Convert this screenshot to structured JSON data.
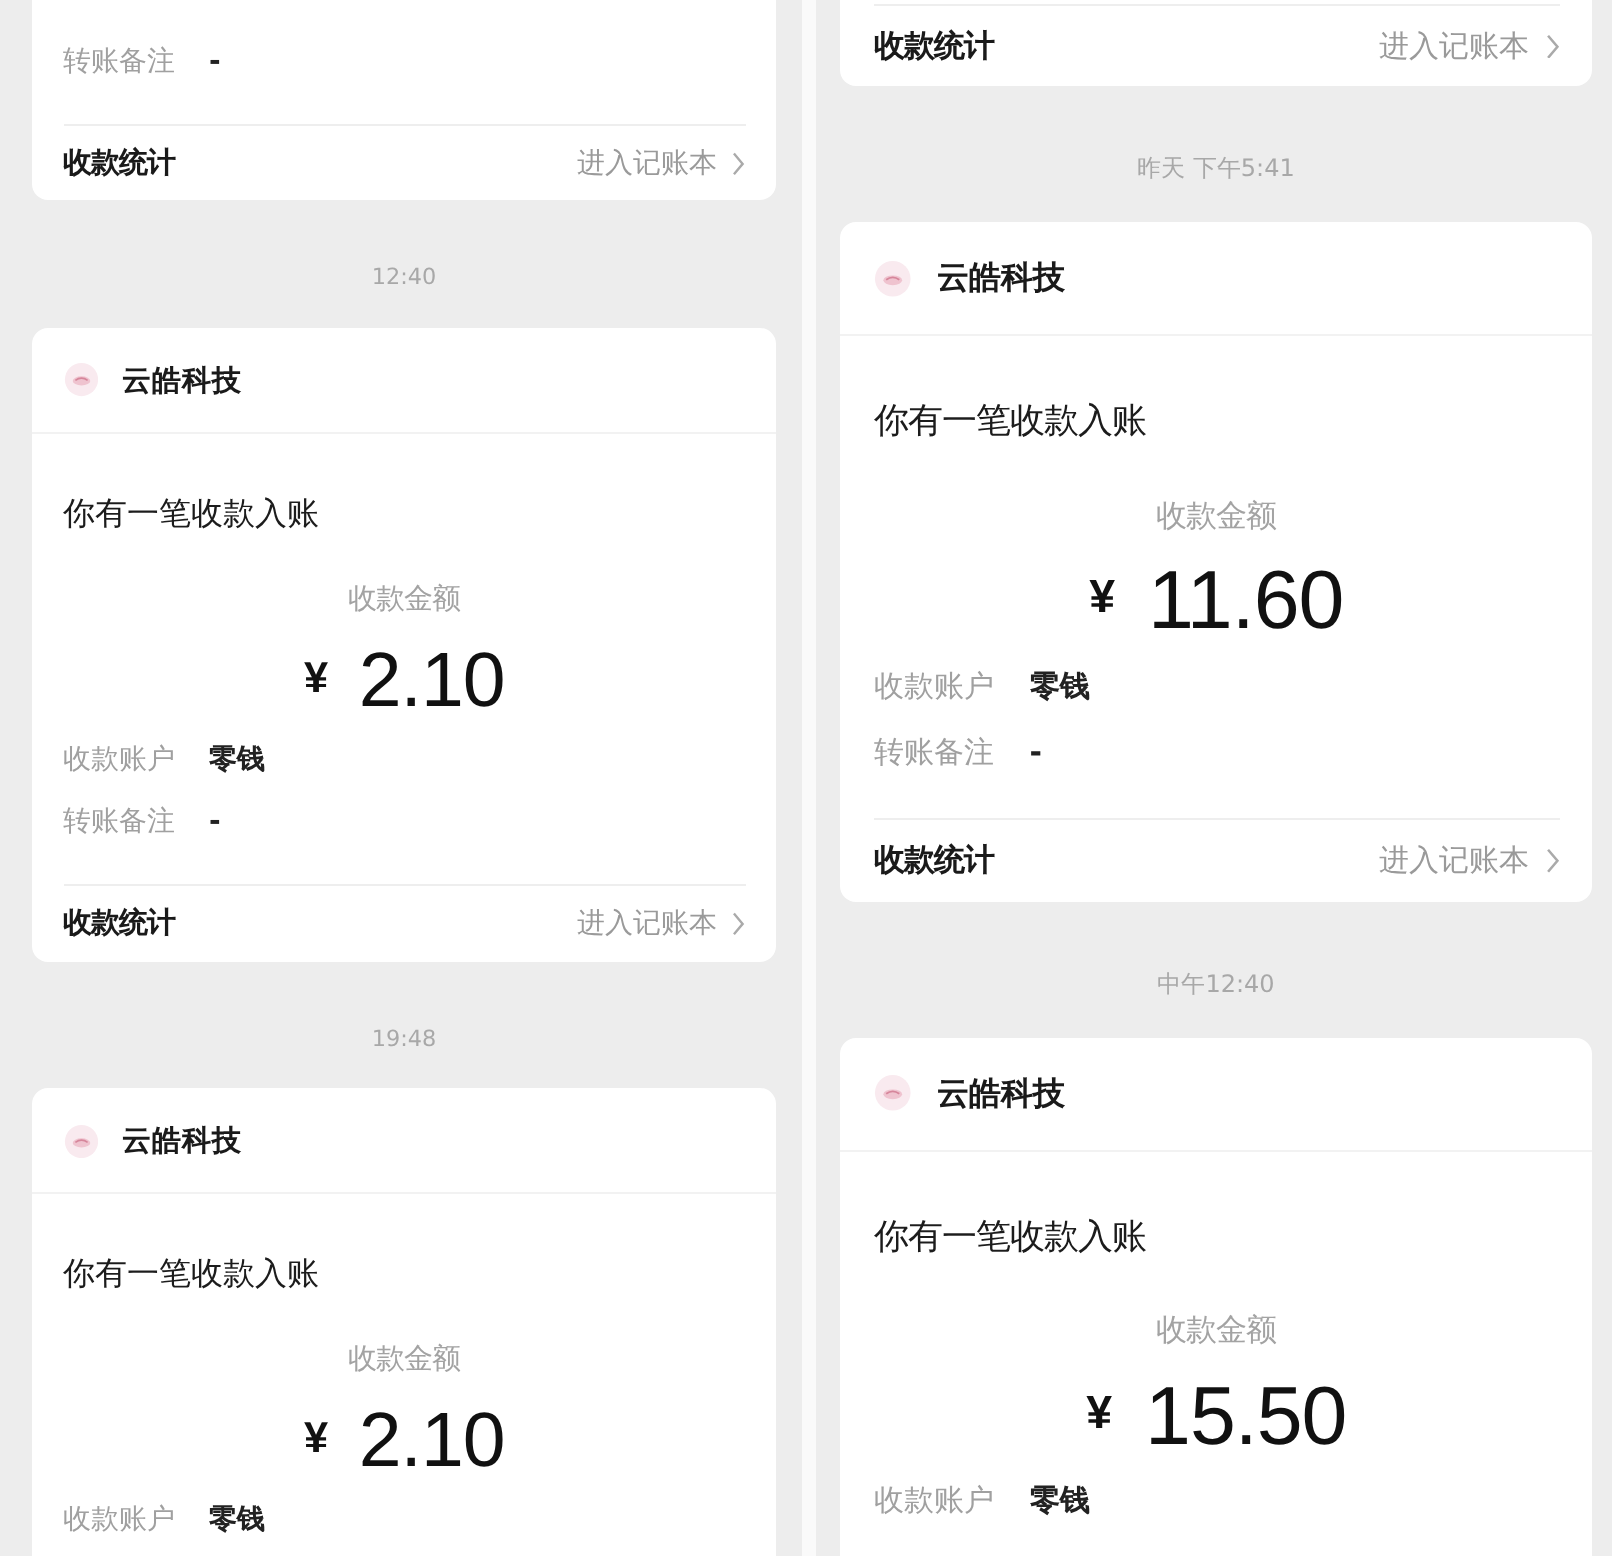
{
  "panels": [
    {
      "items": [
        {
          "kind": "card",
          "details": [
            {
              "label": "转账备注",
              "value": "-"
            }
          ],
          "footer": {
            "label": "收款统计",
            "link": "进入记账本"
          }
        },
        {
          "kind": "timestamp",
          "text": "12:40"
        },
        {
          "kind": "card",
          "merchant": "云皓科技",
          "message": "你有一笔收款入账",
          "amount_label": "收款金额",
          "currency": "¥",
          "amount": "2.10",
          "details": [
            {
              "label": "收款账户",
              "value": "零钱"
            },
            {
              "label": "转账备注",
              "value": "-"
            }
          ],
          "footer": {
            "label": "收款统计",
            "link": "进入记账本"
          }
        },
        {
          "kind": "timestamp",
          "text": "19:48"
        },
        {
          "kind": "card",
          "merchant": "云皓科技",
          "message": "你有一笔收款入账",
          "amount_label": "收款金额",
          "currency": "¥",
          "amount": "2.10",
          "details": [
            {
              "label": "收款账户",
              "value": "零钱"
            }
          ]
        }
      ]
    },
    {
      "items": [
        {
          "kind": "card",
          "footer": {
            "label": "收款统计",
            "link": "进入记账本"
          }
        },
        {
          "kind": "timestamp",
          "text": "昨天 下午5:41"
        },
        {
          "kind": "card",
          "merchant": "云皓科技",
          "message": "你有一笔收款入账",
          "amount_label": "收款金额",
          "currency": "¥",
          "amount": "11.60",
          "details": [
            {
              "label": "收款账户",
              "value": "零钱"
            },
            {
              "label": "转账备注",
              "value": "-"
            }
          ],
          "footer": {
            "label": "收款统计",
            "link": "进入记账本"
          }
        },
        {
          "kind": "timestamp",
          "text": "中午12:40"
        },
        {
          "kind": "card",
          "merchant": "云皓科技",
          "message": "你有一笔收款入账",
          "amount_label": "收款金额",
          "currency": "¥",
          "amount": "15.50",
          "details": [
            {
              "label": "收款账户",
              "value": "零钱"
            }
          ]
        }
      ]
    }
  ]
}
